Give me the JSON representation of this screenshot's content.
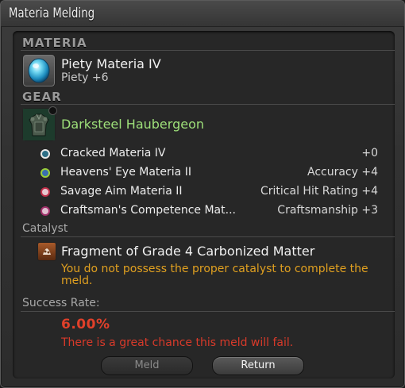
{
  "window": {
    "title": "Materia Melding"
  },
  "materia_section": {
    "heading": "MATERIA",
    "item": {
      "name": "Piety Materia IV",
      "stat": "Piety +6",
      "icon": "blue-materia-orb-icon"
    }
  },
  "gear_section": {
    "heading": "GEAR",
    "item": {
      "name": "Darksteel Haubergeon",
      "icon": "chest-armor-icon",
      "name_color": "#9ee07a"
    },
    "slots": [
      {
        "name": "Cracked Materia IV",
        "stat": "+0",
        "orb_color": "#e8e8e8"
      },
      {
        "name": "Heavens' Eye Materia II",
        "stat": "Accuracy +4",
        "orb_color": "#9acf3a"
      },
      {
        "name": "Savage Aim Materia II",
        "stat": "Critical Hit Rating +4",
        "orb_color": "#c0304a"
      },
      {
        "name": "Craftsman's Competence Mat...",
        "stat": "Craftsmanship +3",
        "orb_color": "#a0306a"
      }
    ]
  },
  "catalyst_section": {
    "heading": "Catalyst",
    "item": {
      "name": "Fragment of Grade 4 Carbonized Matter",
      "icon": "carbonized-matter-icon"
    },
    "warning": "You do not possess the proper catalyst to complete the meld.",
    "warning_color": "#e0a020"
  },
  "success_section": {
    "heading": "Success Rate:",
    "rate": "6.00%",
    "message": "There is a great chance this meld will fail.",
    "rate_color": "#e0402a"
  },
  "buttons": {
    "meld": "Meld",
    "return": "Return"
  }
}
